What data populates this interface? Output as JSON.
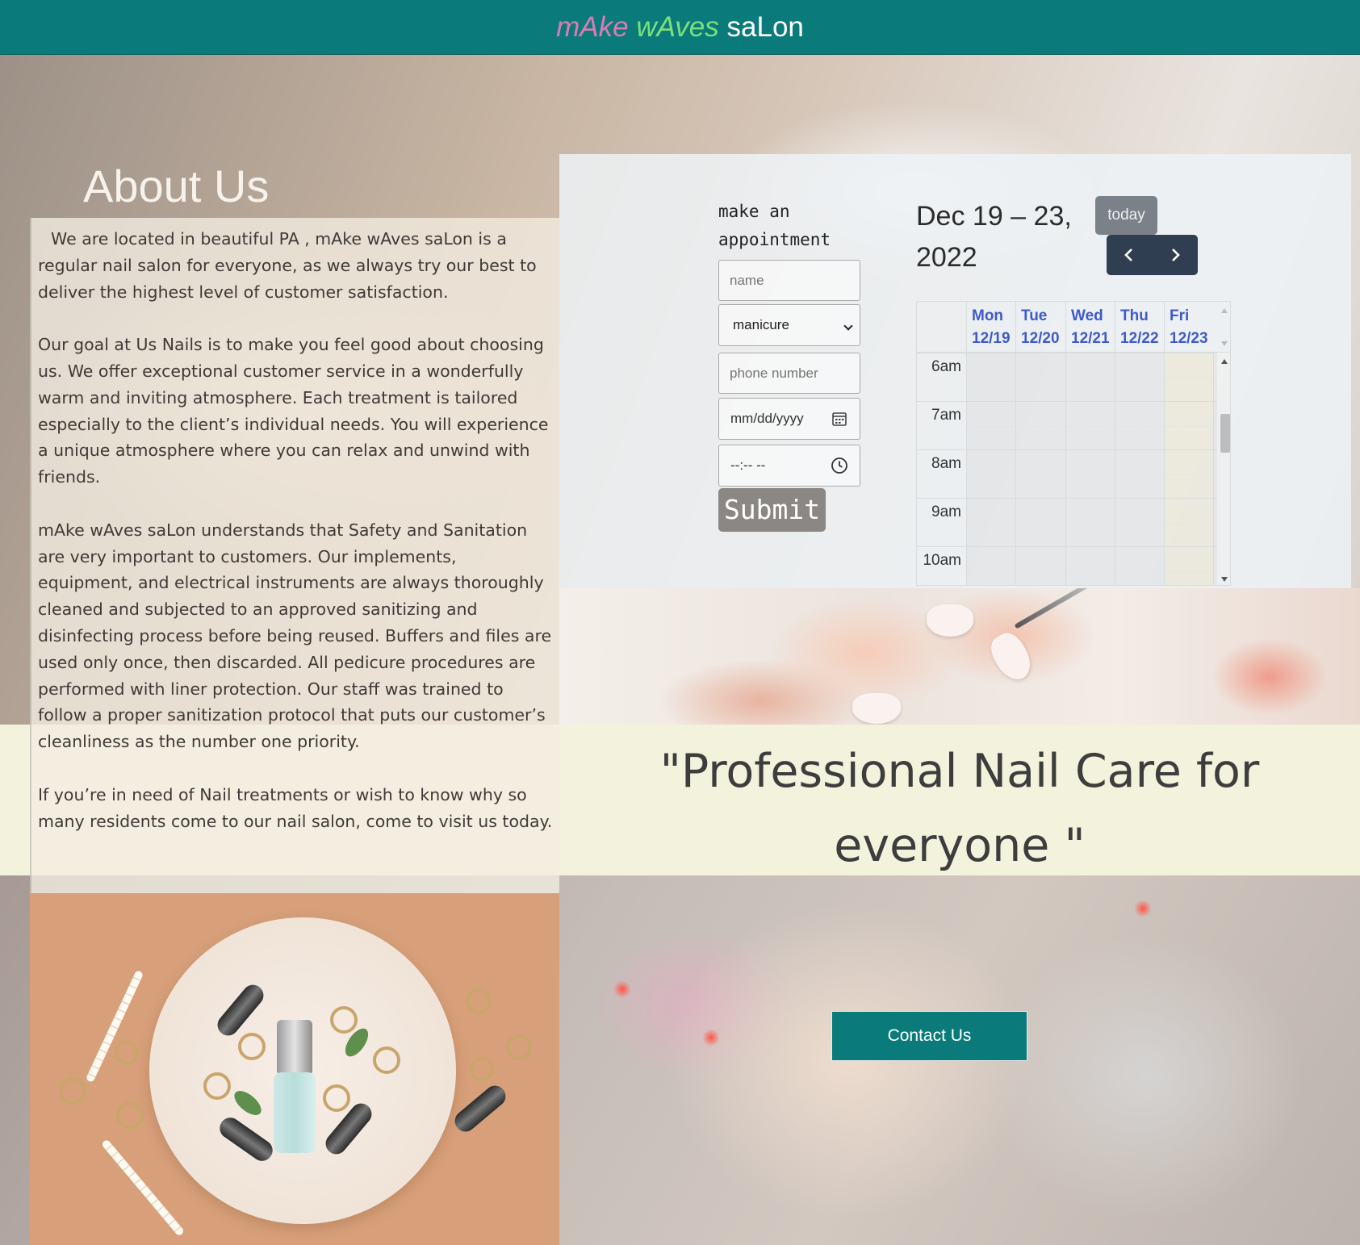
{
  "header": {
    "brand_part1": "mAke",
    "brand_part2": "wAves",
    "brand_part3": "saLon"
  },
  "about": {
    "title": "About Us",
    "paragraphs": [
      "We are located in beautiful PA , mAke wAves saLon is a regular nail salon for everyone, as we always try our best to deliver the highest level of customer satisfaction.",
      "Our goal at Us Nails is to make you feel good about choosing us. We offer exceptional customer service in a wonderfully warm and inviting atmosphere. Each treatment is tailored especially to the client’s individual needs. You will experience a unique atmosphere where you can relax and unwind with friends.",
      "mAke wAves saLon understands that Safety and Sanitation are very important to customers. Our implements, equipment, and electrical instruments are always thoroughly cleaned and subjected to an approved sanitizing and disinfecting process before being reused. Buffers and files are used only once, then discarded. All pedicure procedures are performed with liner protection. Our staff was trained to follow a proper sanitization protocol that puts our customer’s cleanliness as the number one priority.",
      "If you’re in need of Nail treatments or wish to know why so many residents come to our nail salon, come to visit us today."
    ]
  },
  "appointment": {
    "title": "make an appointment",
    "name_placeholder": "name",
    "service_selected": "manicure",
    "phone_placeholder": "phone number",
    "date_placeholder": "mm/dd/yyyy",
    "time_placeholder": "--:-- --",
    "submit_label": "Submit"
  },
  "calendar": {
    "range_title": "Dec 19 – 23, 2022",
    "today_label": "today",
    "prev_icon": "chevron-left-icon",
    "next_icon": "chevron-right-icon",
    "days": [
      {
        "dow": "Mon",
        "date": "12/19"
      },
      {
        "dow": "Tue",
        "date": "12/20"
      },
      {
        "dow": "Wed",
        "date": "12/21"
      },
      {
        "dow": "Thu",
        "date": "12/22"
      },
      {
        "dow": "Fri",
        "date": "12/23"
      }
    ],
    "time_slots": [
      "6am",
      "7am",
      "8am",
      "9am",
      "10am"
    ]
  },
  "quote": {
    "text": "\"Professional Nail Care for everyone \""
  },
  "contact": {
    "label": "Contact Us"
  },
  "colors": {
    "brand_teal": "#0a7b7a",
    "brand_pink": "#d97cb5",
    "brand_green": "#7be07b",
    "calendar_day_blue": "#3f5bc9",
    "nav_dark": "#2f3e50",
    "quote_band": "#f3f2dd"
  }
}
